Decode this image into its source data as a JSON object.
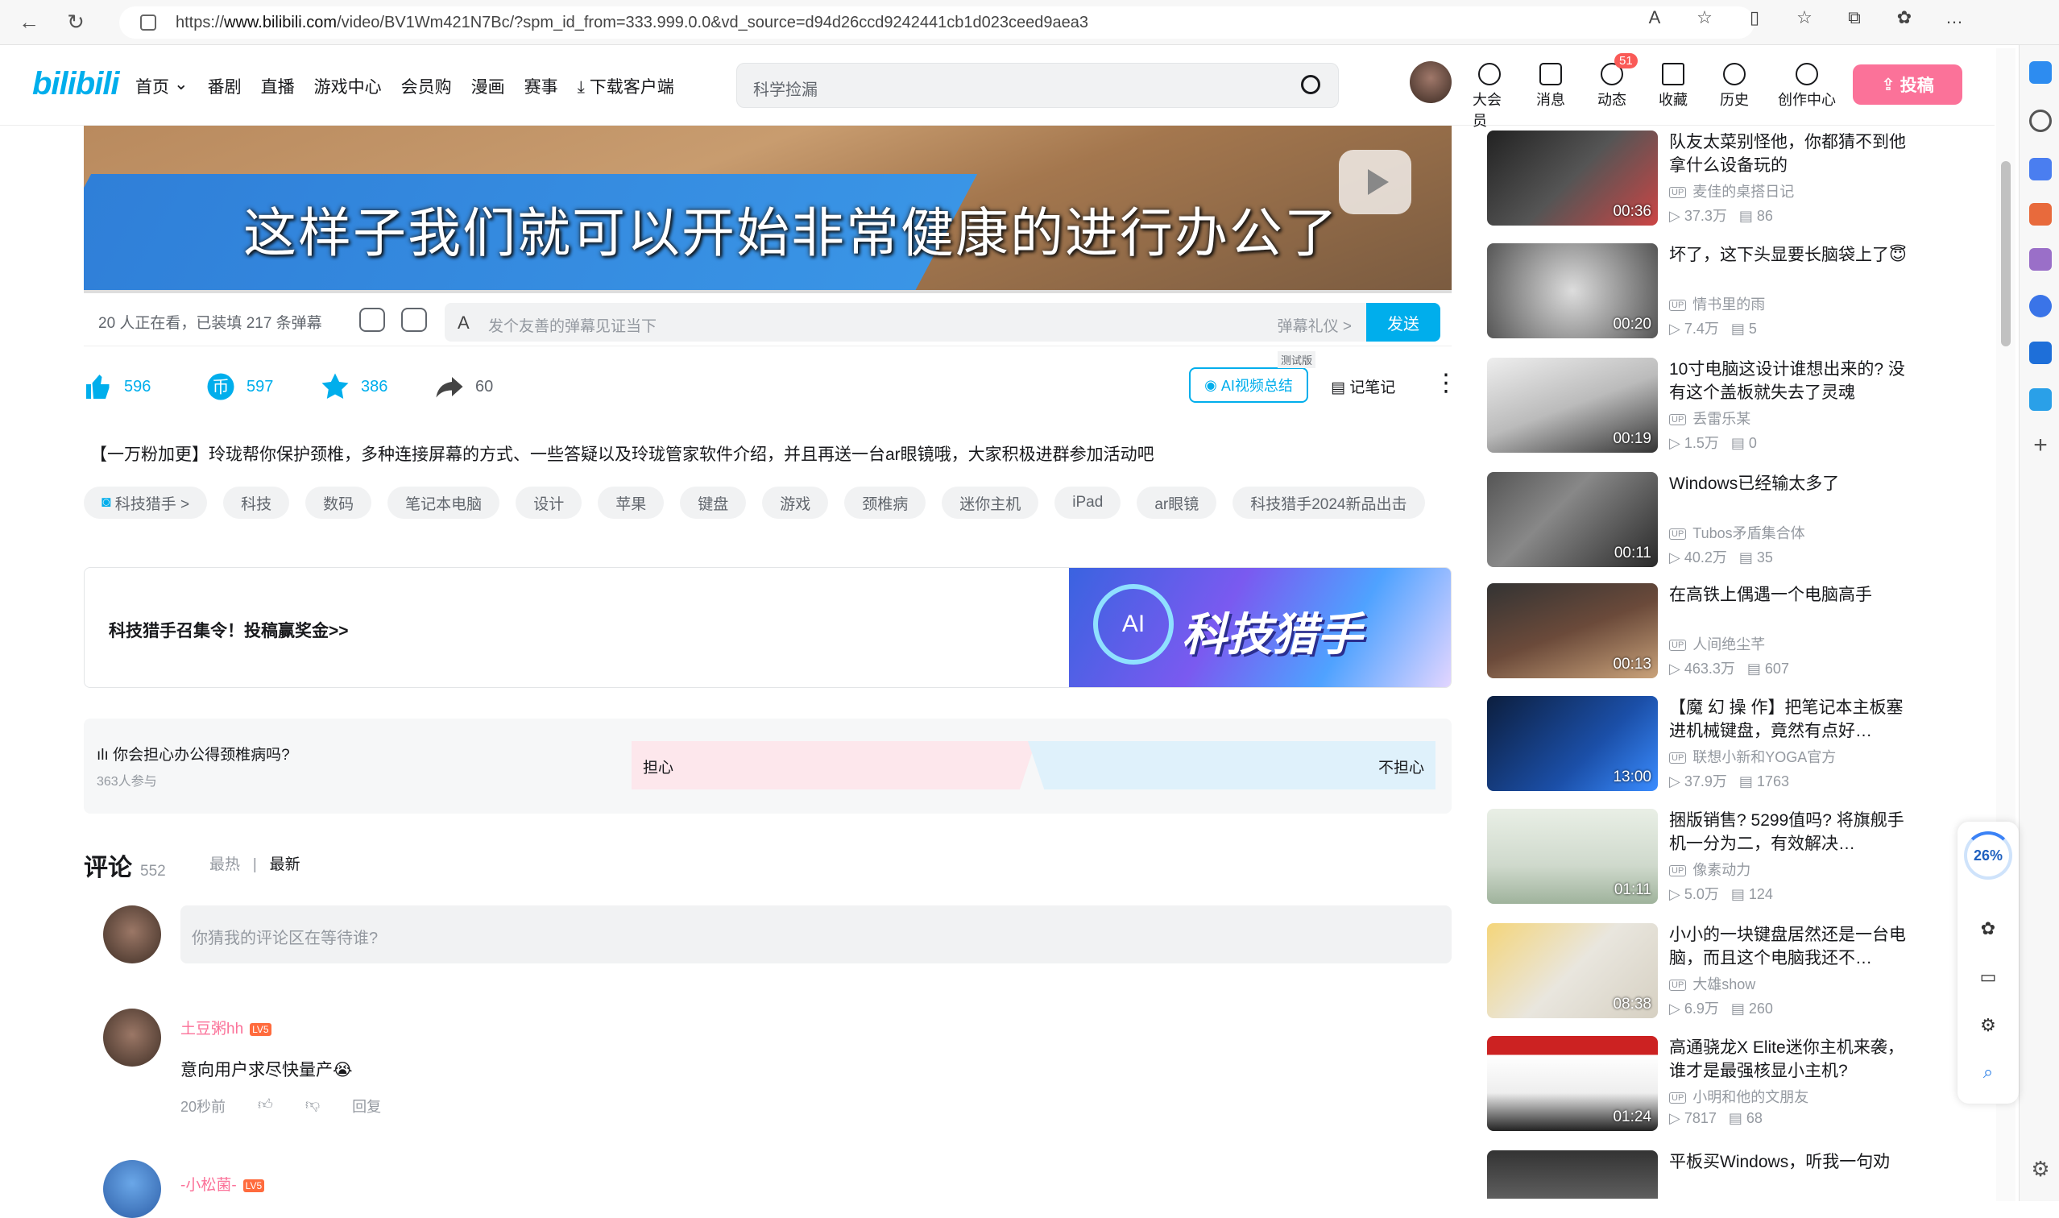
{
  "browser": {
    "url_prefix": "https://",
    "url_host": "www.bilibili.com",
    "url_rest": "/video/BV1Wm421N7Bc/?spm_id_from=333.999.0.0&vd_source=d94d26ccd9242441cb1d023ceed9aea3"
  },
  "header": {
    "logo": "bilibili",
    "nav": [
      "首页",
      "番剧",
      "直播",
      "游戏中心",
      "会员购",
      "漫画",
      "赛事",
      "下载客户端"
    ],
    "search_placeholder": "科学捡漏",
    "items": [
      {
        "label": "大会员",
        "icon": "vip-icon"
      },
      {
        "label": "消息",
        "icon": "message-icon"
      },
      {
        "label": "动态",
        "icon": "dynamic-icon",
        "badge": "51"
      },
      {
        "label": "收藏",
        "icon": "favorite-icon"
      },
      {
        "label": "历史",
        "icon": "history-icon"
      },
      {
        "label": "创作中心",
        "icon": "creator-icon"
      }
    ],
    "upload": "投稿"
  },
  "video": {
    "subtitle": "这样子我们就可以开始非常健康的进行办公了"
  },
  "danmaku": {
    "viewers": "20 人正在看，已装填 217 条弹幕",
    "placeholder": "发个友善的弹幕见证当下",
    "gift": "弹幕礼仪 >",
    "send": "发送"
  },
  "actions": {
    "like": "596",
    "coin": "597",
    "favorite": "386",
    "share": "60",
    "ai_summary": "AI视频总结",
    "ai_tag": "测试版",
    "note": "记笔记"
  },
  "description": "【一万粉加更】玲珑帮你保护颈椎，多种连接屏幕的方式、一些答疑以及玲珑管家软件介绍，并且再送一台ar眼镜哦，大家积极进群参加活动吧",
  "tags": [
    "科技猎手 >",
    "科技",
    "数码",
    "笔记本电脑",
    "设计",
    "苹果",
    "键盘",
    "游戏",
    "颈椎病",
    "迷你主机",
    "iPad",
    "ar眼镜",
    "科技猎手2024新品出击"
  ],
  "promo": {
    "text": "科技猎手召集令！投稿赢奖金>>",
    "banner": "科技猎手",
    "banner_badge": "AI"
  },
  "vote": {
    "question": "你会担心办公得颈椎病吗?",
    "participants": "363人参与",
    "option_yes": "担心",
    "option_no": "不担心"
  },
  "comments": {
    "title": "评论",
    "count": "552",
    "sort_hot": "最热",
    "sort_new": "最新",
    "input_placeholder": "你猜我的评论区在等待谁?",
    "list": [
      {
        "user": "土豆粥hh",
        "level": "LV5",
        "text": "意向用户求尽快量产😭",
        "time": "20秒前",
        "reply": "回复"
      },
      {
        "user": "-小松菌-",
        "level": "LV5",
        "text": "",
        "time": "",
        "reply": ""
      }
    ]
  },
  "recommendations": [
    {
      "title": "队友太菜别怪他，你都猜不到他拿什么设备玩的",
      "up": "麦佳的桌搭日记",
      "views": "37.3万",
      "danmaku": "86",
      "duration": "00:36"
    },
    {
      "title": "坏了，这下头显要长脑袋上了😇",
      "up": "情书里的雨",
      "views": "7.4万",
      "danmaku": "5",
      "duration": "00:20"
    },
    {
      "title": "10寸电脑这设计谁想出来的? 没有这个盖板就失去了灵魂",
      "up": "丢雷乐某",
      "views": "1.5万",
      "danmaku": "0",
      "duration": "00:19"
    },
    {
      "title": "Windows已经输太多了",
      "up": "Tubos矛盾集合体",
      "views": "40.2万",
      "danmaku": "35",
      "duration": "00:11"
    },
    {
      "title": "在高铁上偶遇一个电脑高手",
      "up": "人间绝尘芊",
      "views": "463.3万",
      "danmaku": "607",
      "duration": "00:13"
    },
    {
      "title": "【魔 幻 操 作】把笔记本主板塞进机械键盘，竟然有点好…",
      "up": "联想小新和YOGA官方",
      "views": "37.9万",
      "danmaku": "1763",
      "duration": "13:00"
    },
    {
      "title": "捆版销售? 5299值吗? 将旗舰手机一分为二，有效解决…",
      "up": "像素动力",
      "views": "5.0万",
      "danmaku": "124",
      "duration": "01:11"
    },
    {
      "title": "小小的一块键盘居然还是一台电脑，而且这个电脑我还不…",
      "up": "大雄show",
      "views": "6.9万",
      "danmaku": "260",
      "duration": "08:38"
    },
    {
      "title": "高通骁龙X Elite迷你主机来袭，谁才是最强核显小主机?",
      "up": "小明和他的文朋友",
      "views": "7817",
      "danmaku": "68",
      "duration": "01:24"
    },
    {
      "title": "平板买Windows，听我一句劝",
      "up": "",
      "views": "",
      "danmaku": "",
      "duration": ""
    }
  ],
  "float_panel": {
    "percent": "26%"
  },
  "colors": {
    "accent": "#00aeec",
    "pink": "#fb7299"
  }
}
